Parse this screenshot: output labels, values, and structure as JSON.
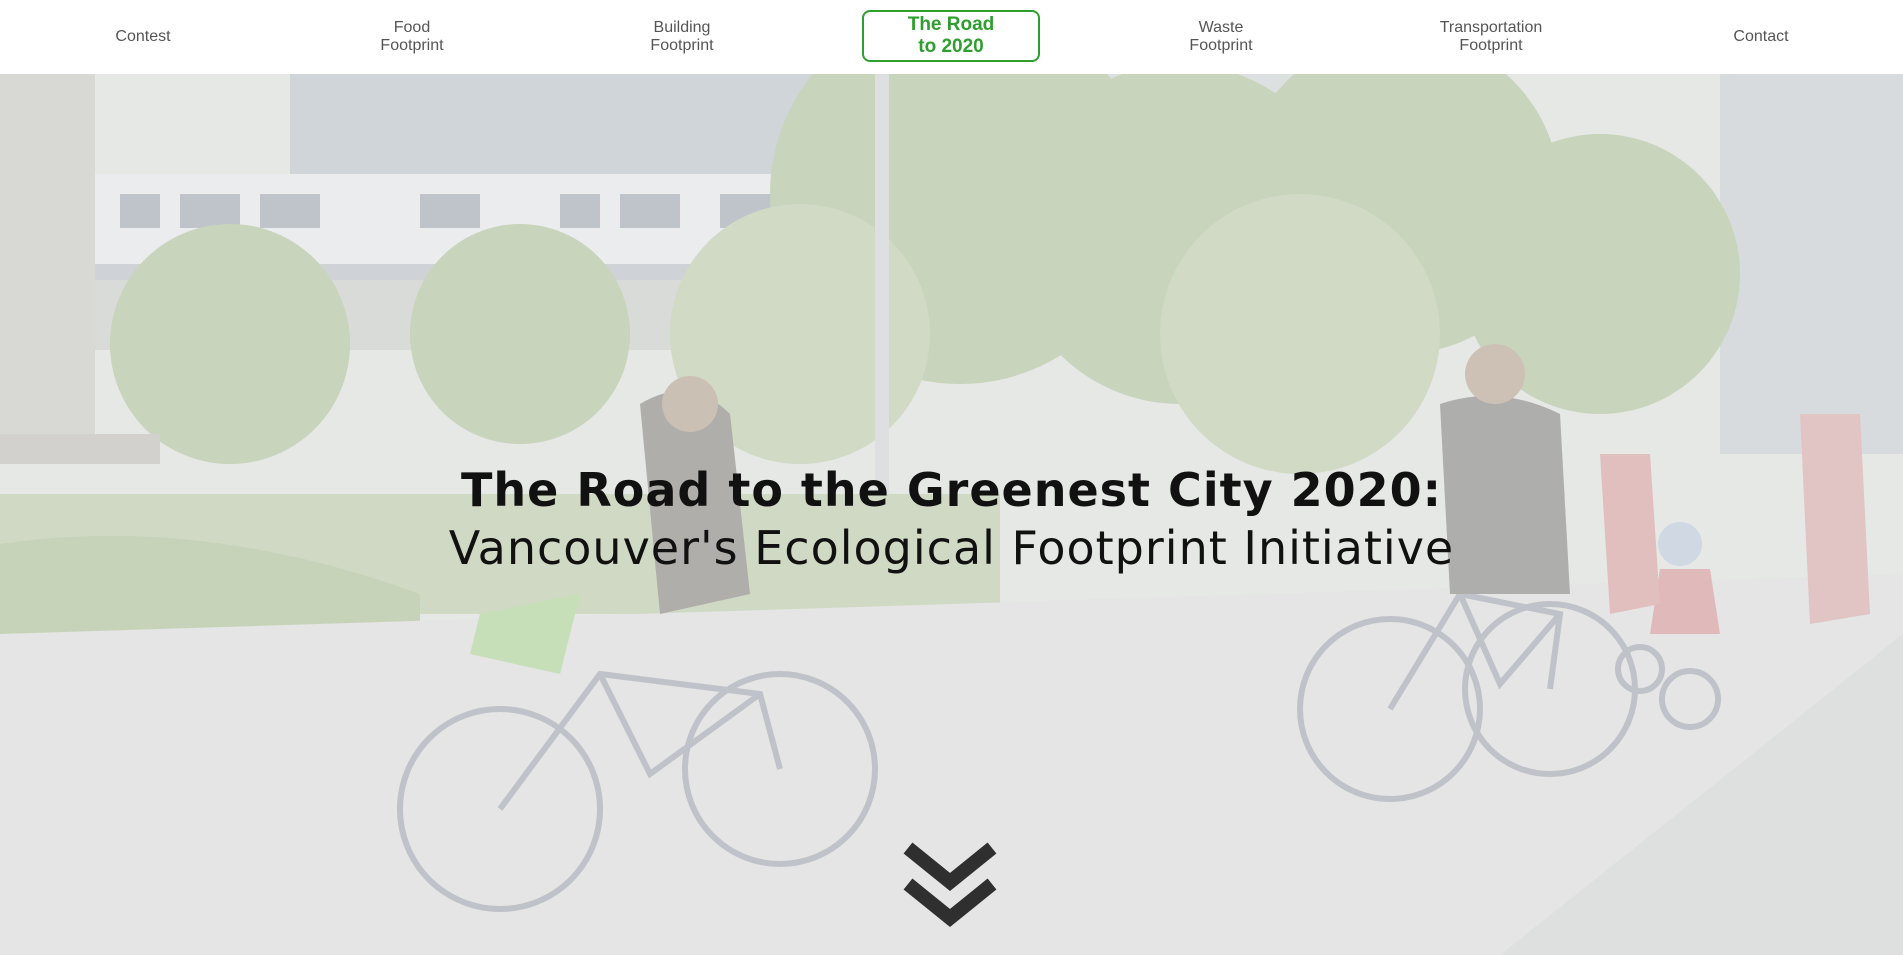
{
  "nav": {
    "items": [
      {
        "line1": "Contest",
        "line2": ""
      },
      {
        "line1": "Food",
        "line2": "Footprint"
      },
      {
        "line1": "Building",
        "line2": "Footprint"
      },
      {
        "line1": "The Road",
        "line2": "to 2020"
      },
      {
        "line1": "Waste",
        "line2": "Footprint"
      },
      {
        "line1": "Transportation",
        "line2": "Footprint"
      },
      {
        "line1": "Contact",
        "line2": ""
      }
    ],
    "active_color": "#2e9e2e"
  },
  "hero": {
    "title": "The Road to the Greenest City 2020:",
    "subtitle": "Vancouver's Ecological Footprint Initiative",
    "background_description_icon": "cyclists-photo",
    "scroll_icon": "double-chevron-down-icon"
  }
}
